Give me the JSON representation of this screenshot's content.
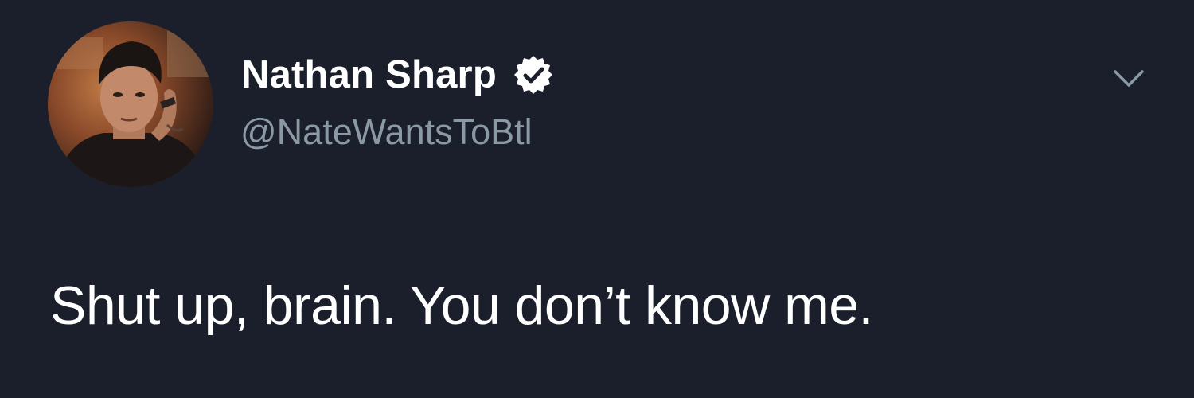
{
  "tweet": {
    "author": {
      "display_name": "Nathan Sharp",
      "handle": "@NateWantsToBtl",
      "verified": true,
      "verified_icon": "verified-badge-icon",
      "avatar": "profile-photo"
    },
    "menu_icon": "chevron-down-icon",
    "text": "Shut up, brain. You don’t know me."
  },
  "colors": {
    "background": "#1a1f2b",
    "primary_text": "#ffffff",
    "secondary_text": "#8b98a5",
    "chevron": "#8b98a5"
  }
}
